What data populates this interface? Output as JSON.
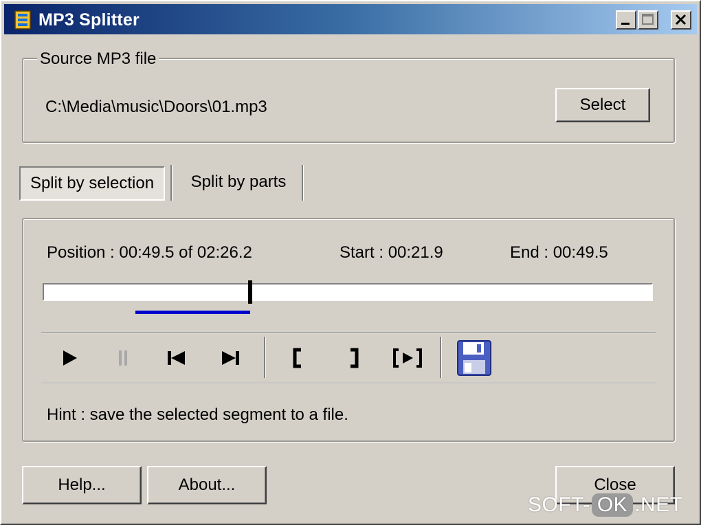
{
  "window": {
    "title": "MP3 Splitter"
  },
  "source": {
    "legend": "Source MP3 file",
    "path": "C:\\Media\\music\\Doors\\01.mp3",
    "select_label": "Select"
  },
  "tabs": [
    "Split by selection",
    "Split by parts"
  ],
  "active_tab": "Split by selection",
  "player": {
    "position": "Position : 00:49.5 of 02:26.2",
    "start": "Start : 00:21.9",
    "end": "End : 00:49.5",
    "position_fraction": 0.339,
    "selection_start_fraction": 0.15,
    "selection_end_fraction": 0.339
  },
  "toolbar": {
    "icons": [
      "play-icon",
      "pause-icon",
      "skip-back-icon",
      "skip-forward-icon",
      "set-start-icon",
      "set-end-icon",
      "play-selection-icon",
      "save-icon"
    ],
    "disabled": [
      "pause-icon"
    ]
  },
  "hint": "Hint : save the selected segment to a file.",
  "buttons": {
    "help": "Help...",
    "about": "About...",
    "close": "Close"
  },
  "watermark": {
    "left": "SOFT-",
    "box": "OK",
    "right": ".NET"
  },
  "colors": {
    "selection": "#0000cc",
    "title_start": "#0a246a",
    "face": "#d4d0c8",
    "save_icon": "#4a5fc1"
  }
}
